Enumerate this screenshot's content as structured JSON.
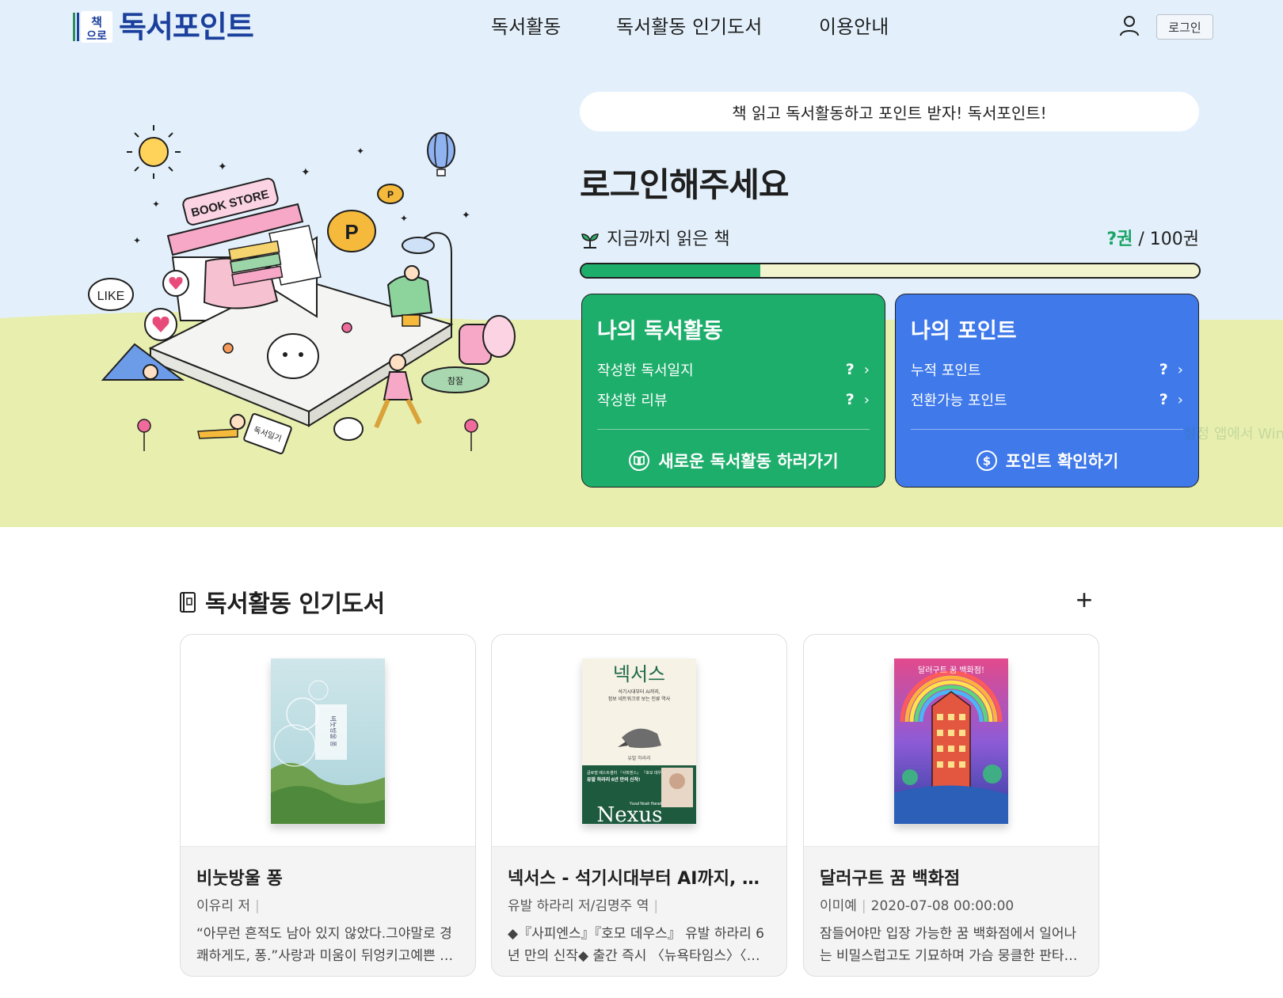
{
  "header": {
    "logo_mark": "책으로",
    "logo_text": "독서포인트",
    "nav": [
      "독서활동",
      "독서활동 인기도서",
      "이용안내"
    ],
    "login_label": "로그인"
  },
  "hero": {
    "slogan": "책 읽고 독서활동하고 포인트 받자! 독서포인트!",
    "login_prompt": "로그인해주세요",
    "read_label": "지금까지 읽은 책",
    "read_count": "?권",
    "read_total": "/ 100권",
    "progress_fraction": 0.29,
    "illustration": {
      "store_sign": "BOOK STORE",
      "like_bubble": "LIKE",
      "coin_letter": "P",
      "diary_text": "독서일기",
      "stamp_text": "참잘"
    },
    "watermark": "설정 앱에서 Windows 정품 인증"
  },
  "activity_card": {
    "title": "나의 독서활동",
    "rows": [
      {
        "label": "작성한 독서일지",
        "value": "?"
      },
      {
        "label": "작성한 리뷰",
        "value": "?"
      }
    ],
    "action": "새로운 독서활동 하러가기"
  },
  "point_card": {
    "title": "나의 포인트",
    "rows": [
      {
        "label": "누적 포인트",
        "value": "?"
      },
      {
        "label": "전환가능 포인트",
        "value": "?"
      }
    ],
    "action": "포인트 확인하기"
  },
  "popular": {
    "title": "독서활동 인기도서",
    "books": [
      {
        "title": "비눗방울 퐁",
        "meta": [
          "이유리 저"
        ],
        "desc": "“아무런 흔적도 남아 있지 않았다.그야말로 경쾌하게도, 퐁.”사랑과 미움이 뒤엉키고예쁜 기억과 슬픈 기억이 한데 섞인",
        "cover_text": "비눗방울 퐁"
      },
      {
        "title": "넥서스 - 석기시대부터 AI까지, 정보 네트워크로 보는 인류 역사",
        "meta": [
          "유발 하라리 저/김명주 역"
        ],
        "desc": "◆『사피엔스』『호모 데우스』 유발 하라리 6년 만의 신작◆ 출간 즉시 〈뉴욕타임스〉〈선데이타임스〉 베스트셀러",
        "cover_title": "넥서스",
        "cover_sub1": "석기시대부터 AI까지,",
        "cover_sub2": "정보 네트워크로 보는 인류 역사",
        "cover_author": "유발 하라리",
        "cover_band1": "글로벌 베스트셀러 『사피엔스』 『호모 데우스』",
        "cover_band2": "유발 하라리 6년 만의 신작!",
        "cover_en_author": "Yuval Noah Harari",
        "cover_en_title": "Nexus"
      },
      {
        "title": "달러구트 꿈 백화점",
        "meta": [
          "이미예",
          "2020-07-08 00:00:00"
        ],
        "desc": "잠들어야만 입장 가능한 꿈 백화점에서 일어나는 비밀스럽고도 기묘하며 가슴 뭉클한 판타지 소설",
        "cover_text": "달러구트 꿈 백화점!"
      }
    ]
  },
  "colors": {
    "sky": "#e3f0fb",
    "grass": "#e8eeae",
    "green_card": "#1eae6c",
    "blue_card": "#3f79ea",
    "logo_blue": "#1b3f9c",
    "progress_fill": "#1dae6c",
    "progress_track": "#f2f3cf"
  }
}
